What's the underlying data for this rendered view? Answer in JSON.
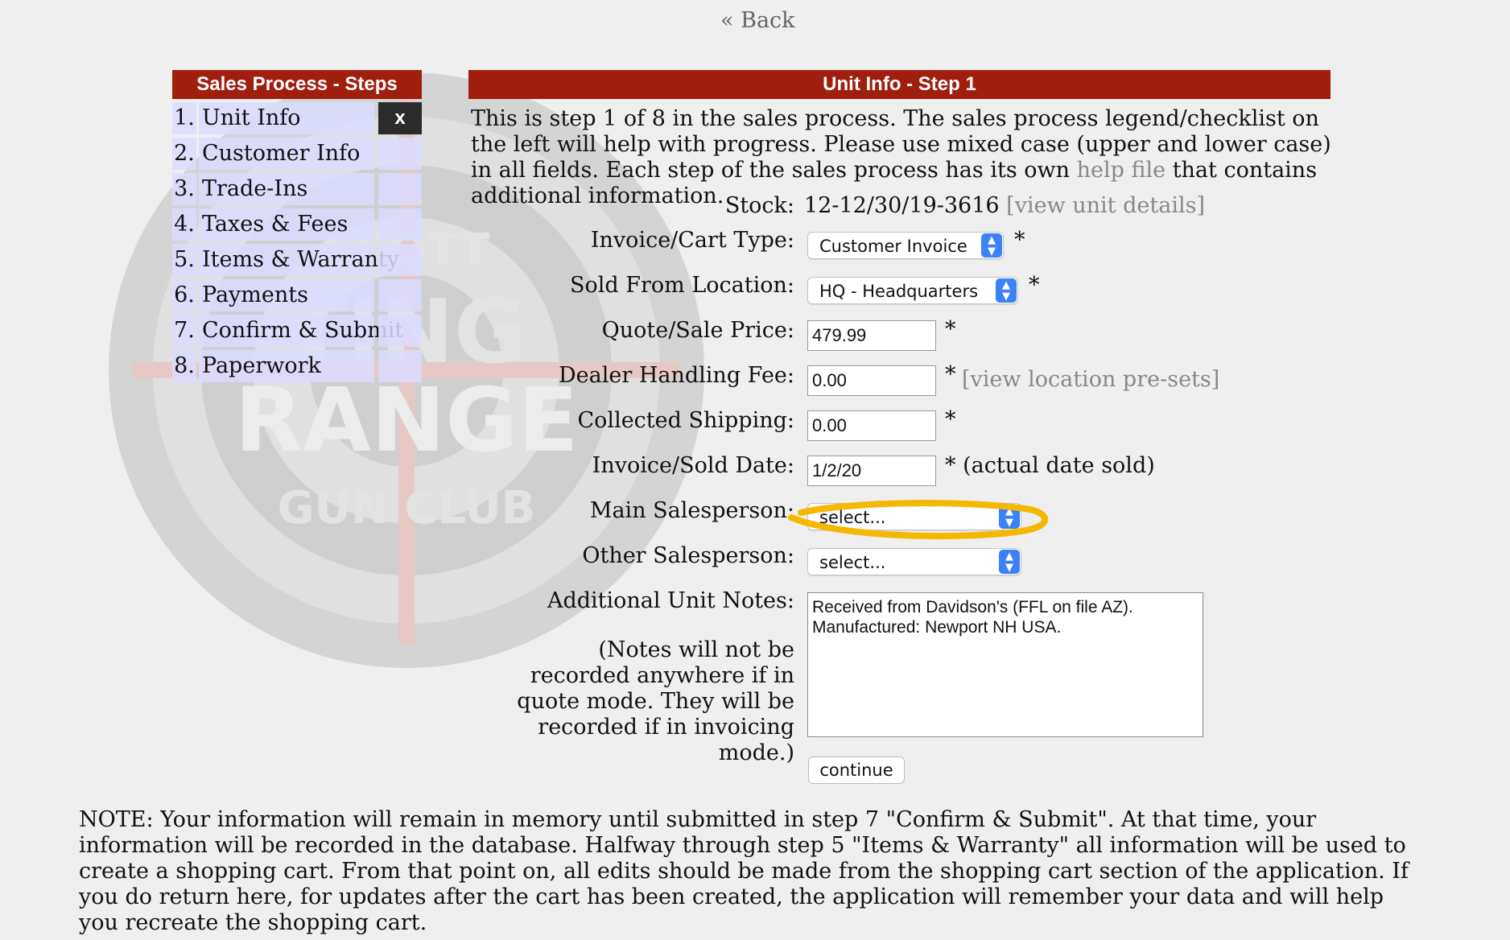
{
  "nav": {
    "back_label": "« Back"
  },
  "sidebar": {
    "title": "Sales Process - Steps",
    "active_marker": "x",
    "steps": [
      {
        "num": "1.",
        "label": "Unit Info"
      },
      {
        "num": "2.",
        "label": "Customer Info"
      },
      {
        "num": "3.",
        "label": "Trade-Ins"
      },
      {
        "num": "4.",
        "label": "Taxes & Fees"
      },
      {
        "num": "5.",
        "label": "Items & Warranty"
      },
      {
        "num": "6.",
        "label": "Payments"
      },
      {
        "num": "7.",
        "label": "Confirm & Submit"
      },
      {
        "num": "8.",
        "label": "Paperwork"
      }
    ]
  },
  "main": {
    "title": "Unit Info - Step 1",
    "intro_before": "This is step 1 of 8 in the sales process. The sales process legend/checklist on the left will help with progress. Please use mixed case (upper and lower case) in all fields. Each step of the sales process has its own ",
    "intro_link": "help file",
    "intro_after": " that contains additional information."
  },
  "form": {
    "stock": {
      "label": "Stock:",
      "value": "12-12/30/19-3616",
      "link": "[view unit details]"
    },
    "cart_type": {
      "label": "Invoice/Cart Type:",
      "value": "Customer Invoice",
      "required": "*"
    },
    "location": {
      "label": "Sold From Location:",
      "value": "HQ - Headquarters",
      "required": "*"
    },
    "price": {
      "label": "Quote/Sale Price:",
      "value": "479.99",
      "required": "*"
    },
    "handling": {
      "label": "Dealer Handling Fee:",
      "value": "0.00",
      "required": "*",
      "link": "[view location pre-sets]"
    },
    "shipping": {
      "label": "Collected Shipping:",
      "value": "0.00",
      "required": "*"
    },
    "date": {
      "label": "Invoice/Sold Date:",
      "value": "1/2/20",
      "required": "*",
      "hint": "(actual date sold)"
    },
    "main_sales": {
      "label": "Main Salesperson:",
      "value": "select..."
    },
    "other_sales": {
      "label": "Other Salesperson:",
      "value": "select..."
    },
    "notes": {
      "label": "Additional Unit Notes:",
      "explain": "(Notes will not be recorded anywhere if in quote mode. They will be recorded if in invoicing mode.)",
      "line1": "Received from Davidson's (FFL on file AZ).",
      "line2": "Manufactured: Newport NH USA."
    },
    "continue_label": "continue"
  },
  "footer_note": "NOTE: Your information will remain in memory until submitted in step 7 \"Confirm & Submit\". At that time, your information will be recorded in the database. Halfway through step 5 \"Items & Warranty\" all information will be used to create a shopping cart. From that point on, all edits should be made from the shopping cart section of the application. If you do return here, for updates after the cart has been created, the application will remember your data and will help you recreate the shopping cart.",
  "colors": {
    "header_red": "#a01e0e",
    "step_bg": "#dadcff",
    "highlight": "#f5b700",
    "select_blue": "#3b82f6"
  },
  "icons": {
    "select_arrows": "chevron-updown-icon"
  }
}
